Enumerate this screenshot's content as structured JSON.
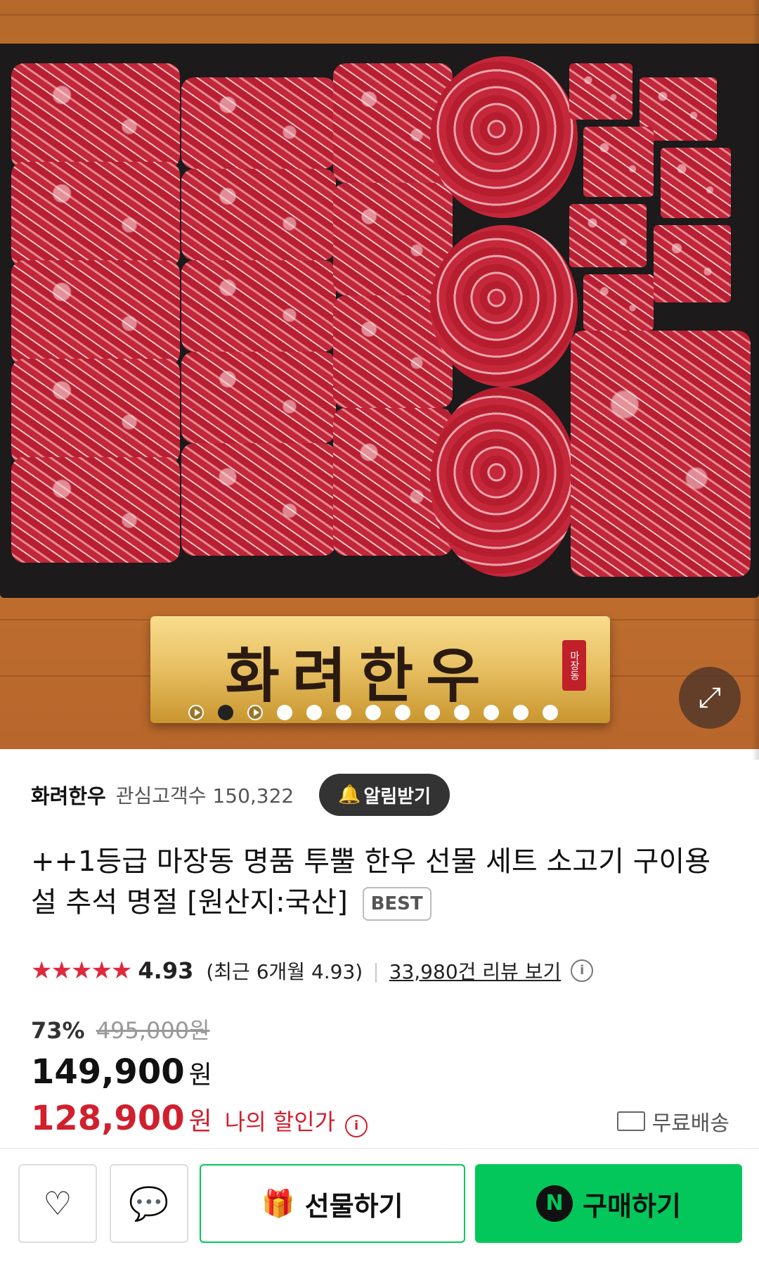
{
  "hero": {
    "banner_text": "화려한우",
    "seal_text": "마장동",
    "expand_icon": "expand-icon",
    "slide_count": 13,
    "active_slide": 2
  },
  "store": {
    "name": "화려한우",
    "fans_label": "관심고객수 150,322",
    "alarm_label": "알림받기",
    "alarm_icon": "bell-icon"
  },
  "product": {
    "title": "++1등급 마장동 명품 투뿔 한우 선물 세트 소고기 구이용 설 추석 명절 [원산지:국산]",
    "badge": "BEST"
  },
  "rating": {
    "stars": "★★★★★",
    "score": "4.93",
    "recent": "(최근 6개월 4.93)",
    "reviews": "33,980건 리뷰 보기",
    "info_icon": "info-icon"
  },
  "price": {
    "discount_pct": "73%",
    "original": "495,000원",
    "sale": "149,900",
    "won": "원",
    "my_price": "128,900",
    "my_label": "나의 할인가",
    "shipping": "무료배송"
  },
  "bottom_bar": {
    "wishlist_icon": "heart-icon",
    "chat_icon": "chat-icon",
    "gift_label": "선물하기",
    "gift_icon": "gift-icon",
    "buy_label": "구매하기",
    "buy_logo": "N"
  },
  "colors": {
    "accent_green": "#03c75a",
    "sale_red": "#d0202e",
    "star_red": "#e0293d"
  }
}
